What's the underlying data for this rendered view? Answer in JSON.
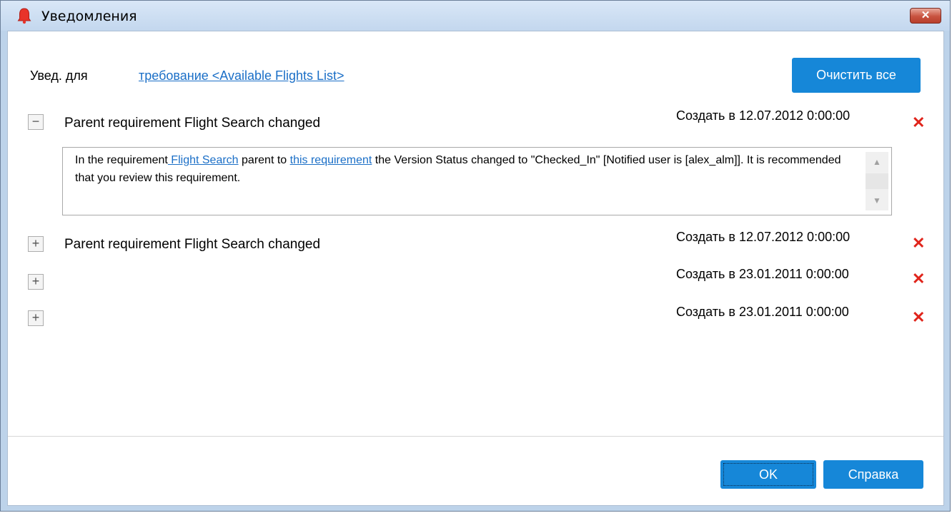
{
  "window": {
    "title": "Уведомления",
    "close_glyph": "✕"
  },
  "header": {
    "notify_label": "Увед. для",
    "notify_link": "требование <Available Flights List>",
    "clear_all": "Очистить все"
  },
  "notifications": [
    {
      "expanded": true,
      "toggle": "−",
      "title": "Parent requirement Flight Search changed",
      "created": "Создать в 12.07.2012 0:00:00",
      "delete": "✕",
      "detail": {
        "pre": "In the requirement",
        "link1": " Flight Search",
        "mid": " parent to ",
        "link2": "this requirement",
        "post": " the Version Status changed to \"Checked_In\" [Notified user is [alex_alm]]. It is recommended that you review  this requirement."
      }
    },
    {
      "expanded": false,
      "toggle": "+",
      "title": "Parent requirement Flight Search changed",
      "created": "Создать в 12.07.2012 0:00:00",
      "delete": "✕"
    },
    {
      "expanded": false,
      "toggle": "+",
      "title": "",
      "created": "Создать в 23.01.2011 0:00:00",
      "delete": "✕"
    },
    {
      "expanded": false,
      "toggle": "+",
      "title": "",
      "created": "Создать в 23.01.2011 0:00:00",
      "delete": "✕"
    }
  ],
  "footer": {
    "ok": "OK",
    "help": "Справка"
  },
  "icons": {
    "bell": "bell-icon",
    "scroll_up": "▲",
    "scroll_down": "▼"
  },
  "colors": {
    "accent": "#1687d8",
    "link": "#1b6fc7",
    "delete": "#e0241b"
  }
}
